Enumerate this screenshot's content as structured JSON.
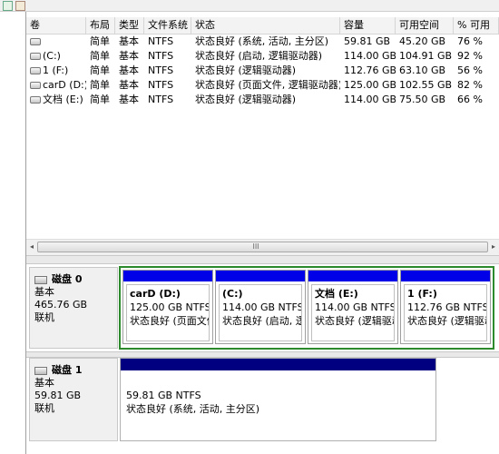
{
  "columns": [
    "卷",
    "布局",
    "类型",
    "文件系统",
    "状态",
    "容量",
    "可用空间",
    "% 可用"
  ],
  "volumes": [
    {
      "name": "",
      "layout": "简单",
      "type": "基本",
      "fs": "NTFS",
      "status": "状态良好 (系统, 活动, 主分区)",
      "capacity": "59.81 GB",
      "free": "45.20 GB",
      "pct": "76 %"
    },
    {
      "name": "(C:)",
      "layout": "简单",
      "type": "基本",
      "fs": "NTFS",
      "status": "状态良好 (启动, 逻辑驱动器)",
      "capacity": "114.00 GB",
      "free": "104.91 GB",
      "pct": "92 %"
    },
    {
      "name": "1 (F:)",
      "layout": "简单",
      "type": "基本",
      "fs": "NTFS",
      "status": "状态良好 (逻辑驱动器)",
      "capacity": "112.76 GB",
      "free": "63.10 GB",
      "pct": "56 %"
    },
    {
      "name": "carD (D:)",
      "layout": "简单",
      "type": "基本",
      "fs": "NTFS",
      "status": "状态良好 (页面文件, 逻辑驱动器)",
      "capacity": "125.00 GB",
      "free": "102.55 GB",
      "pct": "82 %"
    },
    {
      "name": "文档 (E:)",
      "layout": "简单",
      "type": "基本",
      "fs": "NTFS",
      "status": "状态良好 (逻辑驱动器)",
      "capacity": "114.00 GB",
      "free": "75.50 GB",
      "pct": "66 %"
    }
  ],
  "scrollbar": {
    "left_arrow": "◂",
    "right_arrow": "▸",
    "grip": "III"
  },
  "disks": [
    {
      "title": "磁盘 0",
      "type": "基本",
      "size": "465.76 GB",
      "state": "联机",
      "partitions": [
        {
          "name": "carD  (D:)",
          "fs": "125.00 GB NTFS",
          "status": "状态良好 (页面文件"
        },
        {
          "name": "(C:)",
          "fs": "114.00 GB NTFS",
          "status": "状态良好 (启动, 逻"
        },
        {
          "name": "文档  (E:)",
          "fs": "114.00 GB NTFS",
          "status": "状态良好 (逻辑驱动"
        },
        {
          "name": "1  (F:)",
          "fs": "112.76 GB NTFS",
          "status": "状态良好 (逻辑驱动"
        }
      ]
    },
    {
      "title": "磁盘 1",
      "type": "基本",
      "size": "59.81 GB",
      "state": "联机",
      "partitions": [
        {
          "name": "",
          "fs": "59.81 GB NTFS",
          "status": "状态良好 (系统, 活动, 主分区)"
        }
      ]
    }
  ],
  "colors": {
    "partition_primary": "#0000e8",
    "partition_system": "#000080",
    "selection_border": "#2c8a2c"
  }
}
